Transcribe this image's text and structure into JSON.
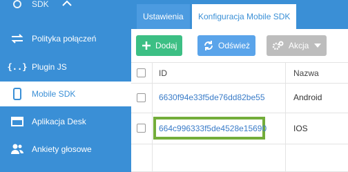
{
  "sidebar": {
    "partial_item": {
      "label": "SDK",
      "icon": "gear-icon"
    },
    "items": [
      {
        "label": "Polityka połączeń",
        "icon": "arrows-exchange-icon"
      },
      {
        "label": "Plugin JS",
        "icon": "code-braces-icon"
      },
      {
        "label": "Mobile SDK",
        "icon": "mobile-phone-icon",
        "active": true
      },
      {
        "label": "Aplikacja Desk",
        "icon": "desk-window-icon"
      },
      {
        "label": "Ankiety głosowe",
        "icon": "people-icon"
      }
    ]
  },
  "tabs": [
    {
      "label": "Ustawienia"
    },
    {
      "label": "Konfiguracja Mobile SDK"
    }
  ],
  "toolbar": {
    "add_label": "Dodaj",
    "refresh_label": "Odśwież",
    "action_label": "Akcja"
  },
  "table": {
    "columns": [
      "ID",
      "Nazwa"
    ],
    "rows": [
      {
        "id": "6630f94e33f5de76dd82be55",
        "name": "Android"
      },
      {
        "id": "664c996333f5de4528e15690",
        "name": "IOS"
      }
    ]
  },
  "colors": {
    "brand": "#3a8fd6",
    "add": "#3cbf84",
    "refresh": "#5aa4ea",
    "action": "#bdbdbd",
    "highlight": "#73ad3a"
  }
}
